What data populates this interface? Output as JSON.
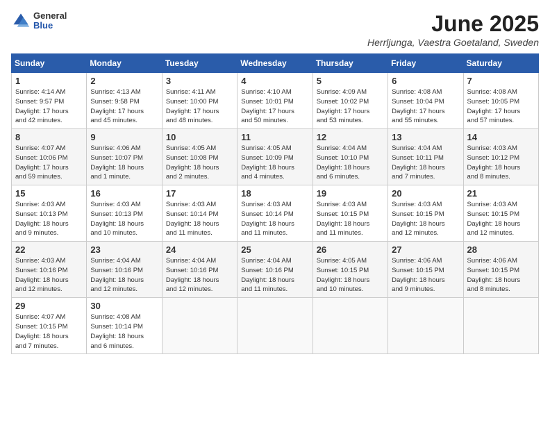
{
  "header": {
    "logo_general": "General",
    "logo_blue": "Blue",
    "month": "June 2025",
    "location": "Herrljunga, Vaestra Goetaland, Sweden"
  },
  "weekdays": [
    "Sunday",
    "Monday",
    "Tuesday",
    "Wednesday",
    "Thursday",
    "Friday",
    "Saturday"
  ],
  "weeks": [
    [
      {
        "day": "1",
        "info": "Sunrise: 4:14 AM\nSunset: 9:57 PM\nDaylight: 17 hours\nand 42 minutes."
      },
      {
        "day": "2",
        "info": "Sunrise: 4:13 AM\nSunset: 9:58 PM\nDaylight: 17 hours\nand 45 minutes."
      },
      {
        "day": "3",
        "info": "Sunrise: 4:11 AM\nSunset: 10:00 PM\nDaylight: 17 hours\nand 48 minutes."
      },
      {
        "day": "4",
        "info": "Sunrise: 4:10 AM\nSunset: 10:01 PM\nDaylight: 17 hours\nand 50 minutes."
      },
      {
        "day": "5",
        "info": "Sunrise: 4:09 AM\nSunset: 10:02 PM\nDaylight: 17 hours\nand 53 minutes."
      },
      {
        "day": "6",
        "info": "Sunrise: 4:08 AM\nSunset: 10:04 PM\nDaylight: 17 hours\nand 55 minutes."
      },
      {
        "day": "7",
        "info": "Sunrise: 4:08 AM\nSunset: 10:05 PM\nDaylight: 17 hours\nand 57 minutes."
      }
    ],
    [
      {
        "day": "8",
        "info": "Sunrise: 4:07 AM\nSunset: 10:06 PM\nDaylight: 17 hours\nand 59 minutes."
      },
      {
        "day": "9",
        "info": "Sunrise: 4:06 AM\nSunset: 10:07 PM\nDaylight: 18 hours\nand 1 minute."
      },
      {
        "day": "10",
        "info": "Sunrise: 4:05 AM\nSunset: 10:08 PM\nDaylight: 18 hours\nand 2 minutes."
      },
      {
        "day": "11",
        "info": "Sunrise: 4:05 AM\nSunset: 10:09 PM\nDaylight: 18 hours\nand 4 minutes."
      },
      {
        "day": "12",
        "info": "Sunrise: 4:04 AM\nSunset: 10:10 PM\nDaylight: 18 hours\nand 6 minutes."
      },
      {
        "day": "13",
        "info": "Sunrise: 4:04 AM\nSunset: 10:11 PM\nDaylight: 18 hours\nand 7 minutes."
      },
      {
        "day": "14",
        "info": "Sunrise: 4:03 AM\nSunset: 10:12 PM\nDaylight: 18 hours\nand 8 minutes."
      }
    ],
    [
      {
        "day": "15",
        "info": "Sunrise: 4:03 AM\nSunset: 10:13 PM\nDaylight: 18 hours\nand 9 minutes."
      },
      {
        "day": "16",
        "info": "Sunrise: 4:03 AM\nSunset: 10:13 PM\nDaylight: 18 hours\nand 10 minutes."
      },
      {
        "day": "17",
        "info": "Sunrise: 4:03 AM\nSunset: 10:14 PM\nDaylight: 18 hours\nand 11 minutes."
      },
      {
        "day": "18",
        "info": "Sunrise: 4:03 AM\nSunset: 10:14 PM\nDaylight: 18 hours\nand 11 minutes."
      },
      {
        "day": "19",
        "info": "Sunrise: 4:03 AM\nSunset: 10:15 PM\nDaylight: 18 hours\nand 11 minutes."
      },
      {
        "day": "20",
        "info": "Sunrise: 4:03 AM\nSunset: 10:15 PM\nDaylight: 18 hours\nand 12 minutes."
      },
      {
        "day": "21",
        "info": "Sunrise: 4:03 AM\nSunset: 10:15 PM\nDaylight: 18 hours\nand 12 minutes."
      }
    ],
    [
      {
        "day": "22",
        "info": "Sunrise: 4:03 AM\nSunset: 10:16 PM\nDaylight: 18 hours\nand 12 minutes."
      },
      {
        "day": "23",
        "info": "Sunrise: 4:04 AM\nSunset: 10:16 PM\nDaylight: 18 hours\nand 12 minutes."
      },
      {
        "day": "24",
        "info": "Sunrise: 4:04 AM\nSunset: 10:16 PM\nDaylight: 18 hours\nand 12 minutes."
      },
      {
        "day": "25",
        "info": "Sunrise: 4:04 AM\nSunset: 10:16 PM\nDaylight: 18 hours\nand 11 minutes."
      },
      {
        "day": "26",
        "info": "Sunrise: 4:05 AM\nSunset: 10:15 PM\nDaylight: 18 hours\nand 10 minutes."
      },
      {
        "day": "27",
        "info": "Sunrise: 4:06 AM\nSunset: 10:15 PM\nDaylight: 18 hours\nand 9 minutes."
      },
      {
        "day": "28",
        "info": "Sunrise: 4:06 AM\nSunset: 10:15 PM\nDaylight: 18 hours\nand 8 minutes."
      }
    ],
    [
      {
        "day": "29",
        "info": "Sunrise: 4:07 AM\nSunset: 10:15 PM\nDaylight: 18 hours\nand 7 minutes."
      },
      {
        "day": "30",
        "info": "Sunrise: 4:08 AM\nSunset: 10:14 PM\nDaylight: 18 hours\nand 6 minutes."
      },
      {
        "day": "",
        "info": ""
      },
      {
        "day": "",
        "info": ""
      },
      {
        "day": "",
        "info": ""
      },
      {
        "day": "",
        "info": ""
      },
      {
        "day": "",
        "info": ""
      }
    ]
  ]
}
